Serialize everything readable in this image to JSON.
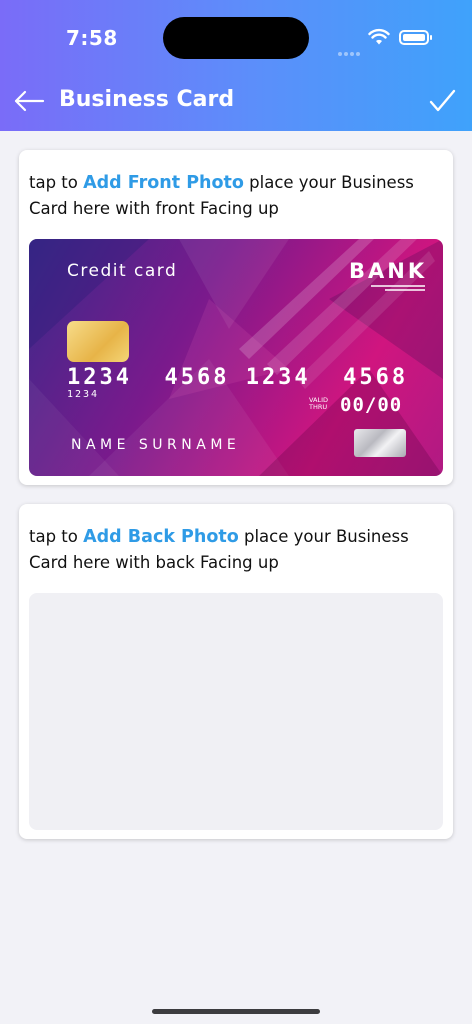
{
  "status_bar": {
    "time": "7:58"
  },
  "header": {
    "title": "Business Card",
    "back_icon": "arrow-left-icon",
    "confirm_icon": "checkmark-icon"
  },
  "colors": {
    "header_gradient_start": "#7a6cf8",
    "header_gradient_end": "#3fa2fb",
    "link": "#2f9be6",
    "background": "#f2f2f7"
  },
  "front_section": {
    "prefix": "tap to ",
    "link": "Add Front Photo",
    "suffix": "  place your Business Card here with front Facing up",
    "card": {
      "label": "Credit card",
      "bank": "BANK",
      "number": "1234  4568 1234  4568",
      "small_number": "1234",
      "valid_thru": "VALID THRU",
      "expiry": "00/00",
      "name": "NAME SURNAME"
    }
  },
  "back_section": {
    "prefix": "tap to ",
    "link": "Add Back Photo",
    "suffix": "  place your Business Card here with back Facing up"
  }
}
